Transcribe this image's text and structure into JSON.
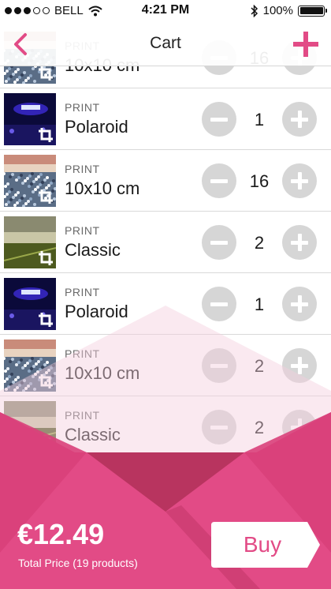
{
  "status_bar": {
    "carrier": "BELL",
    "time": "4:21 PM",
    "battery": "100%",
    "signal_bars": 5,
    "signal_filled": 3,
    "battery_level": 1.0
  },
  "nav": {
    "title": "Cart",
    "back_icon": "chevron-left-icon",
    "add_icon": "plus-icon",
    "accent_color": "#e24b86"
  },
  "items": [
    {
      "type": "PRINT",
      "name": "10x10 cm",
      "qty": "16",
      "photo": "crowd"
    },
    {
      "type": "PRINT",
      "name": "Polaroid",
      "qty": "1",
      "photo": "stage"
    },
    {
      "type": "PRINT",
      "name": "10x10 cm",
      "qty": "16",
      "photo": "crowd"
    },
    {
      "type": "PRINT",
      "name": "Classic",
      "qty": "2",
      "photo": "field"
    },
    {
      "type": "PRINT",
      "name": "Polaroid",
      "qty": "1",
      "photo": "stage"
    },
    {
      "type": "PRINT",
      "name": "10x10 cm",
      "qty": "2",
      "photo": "crowd"
    },
    {
      "type": "PRINT",
      "name": "Classic",
      "qty": "2",
      "photo": "field"
    }
  ],
  "footer": {
    "total_price": "€12.49",
    "price_caption": "Total Price (19 products)",
    "buy_label": "Buy",
    "colors": {
      "pink": "#e24b86",
      "dark_pink": "#b8345f",
      "button_text": "#e24b86"
    }
  }
}
